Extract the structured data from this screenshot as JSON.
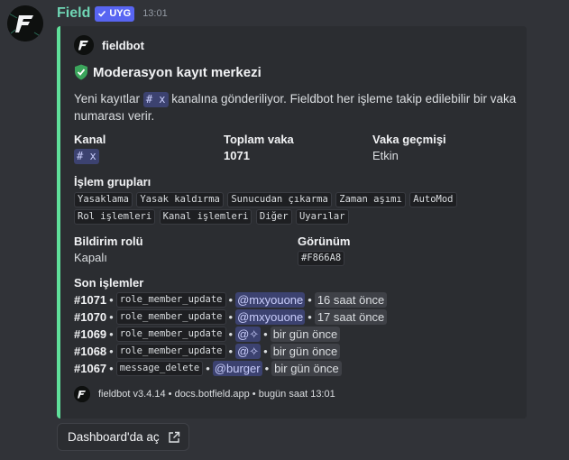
{
  "message": {
    "username": "Field",
    "badge": "UYG",
    "timestamp": "13:01"
  },
  "embed": {
    "accent_color": "#5FE09A",
    "author": "fieldbot",
    "title": "Moderasyon kayıt merkezi",
    "title_icon": "shield-check-icon",
    "description_prefix": "Yeni kayıtlar",
    "description_channel": "# x",
    "description_suffix": "kanalına gönderiliyor. Fieldbot her işleme takip edilebilir bir vaka numarası verir.",
    "fields": {
      "kanal": {
        "name": "Kanal",
        "value": "# x"
      },
      "toplam": {
        "name": "Toplam vaka",
        "value": "1071"
      },
      "gecmis": {
        "name": "Vaka geçmişi",
        "value": "Etkin"
      },
      "gruplar": {
        "name": "İşlem grupları",
        "items": [
          "Yasaklama",
          "Yasak kaldırma",
          "Sunucudan çıkarma",
          "Zaman aşımı",
          "AutoMod",
          "Rol işlemleri",
          "Kanal işlemleri",
          "Diğer",
          "Uyarılar"
        ]
      },
      "bildirim": {
        "name": "Bildirim rolü",
        "value": "Kapalı"
      },
      "gorunum": {
        "name": "Görünüm",
        "value": "#F866A8"
      },
      "son": {
        "name": "Son işlemler",
        "items": [
          {
            "id": "#1071",
            "action": "role_member_update",
            "user": "@mxyouone",
            "time": "16 saat önce"
          },
          {
            "id": "#1070",
            "action": "role_member_update",
            "user": "@mxyouone",
            "time": "17 saat önce"
          },
          {
            "id": "#1069",
            "action": "role_member_update",
            "user": "@✧",
            "time": "bir gün önce"
          },
          {
            "id": "#1068",
            "action": "role_member_update",
            "user": "@✧",
            "time": "bir gün önce"
          },
          {
            "id": "#1067",
            "action": "message_delete",
            "user": "@burger",
            "time": "bir gün önce"
          }
        ]
      }
    },
    "footer": "fieldbot v3.4.14 • docs.botfield.app • bugün saat 13:01"
  },
  "button": {
    "label": "Dashboard'da aç",
    "icon": "external-link-icon"
  }
}
